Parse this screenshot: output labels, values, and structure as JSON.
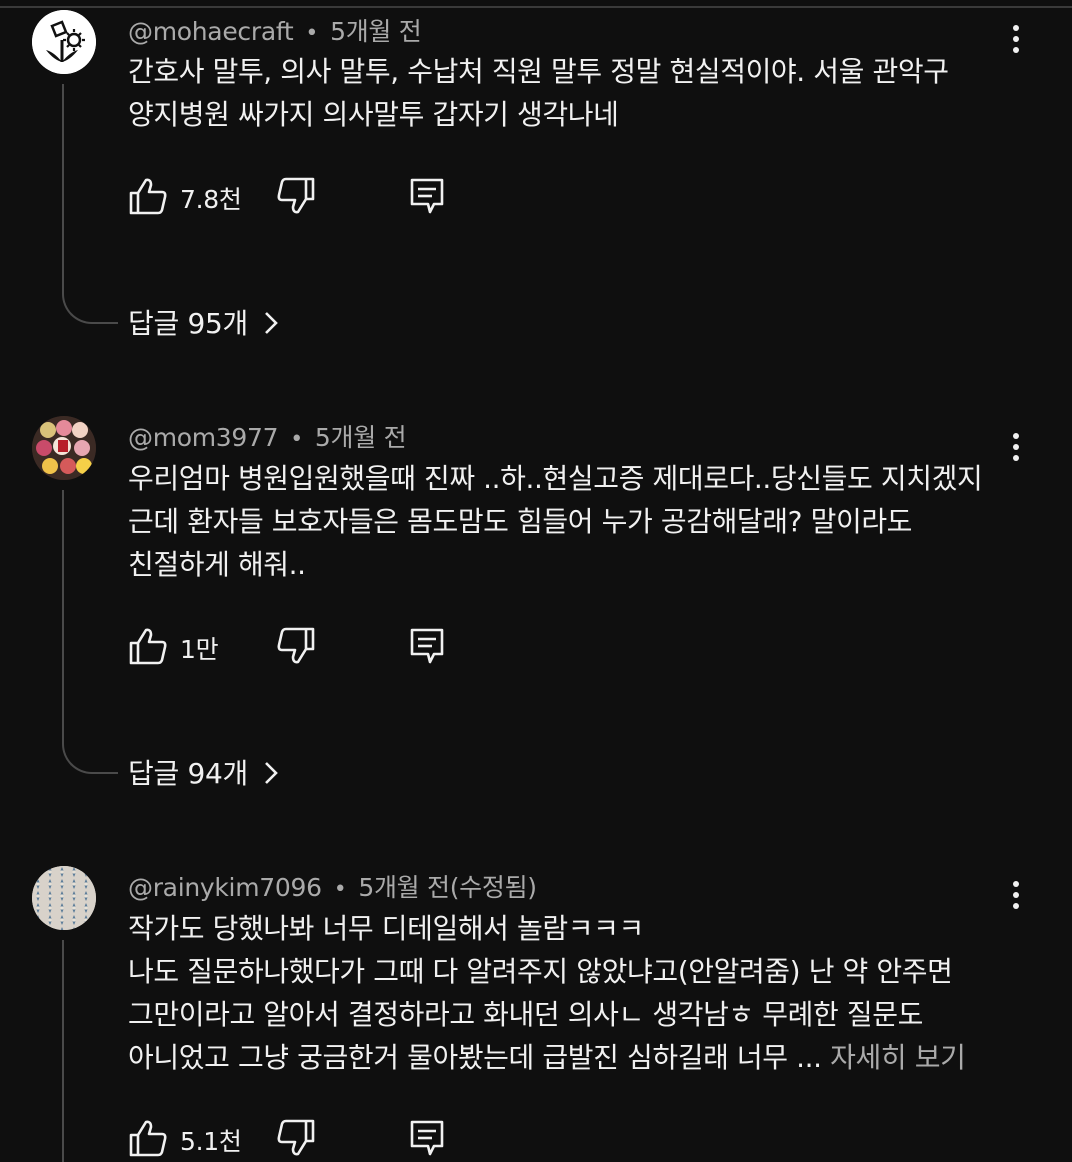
{
  "comments": [
    {
      "handle": "@mohaecraft",
      "time": "5개월 전",
      "lines": [
        "간호사 말투,  의사 말투, 수납처 직원 말투 정말 현실적이야. 서울 관악구",
        "양지병원 싸가지 의사말투 갑자기 생각나네"
      ],
      "likes": "7.8천",
      "replies": "답글 95개"
    },
    {
      "handle": "@mom3977",
      "time": "5개월 전",
      "lines": [
        "우리엄마 병원입원했을때 진짜 ..하..현실고증 제대로다..당신들도 지치겠지",
        "근데 환자들  보호자들은 몸도맘도 힘들어 누가 공감해달래? 말이라도",
        "친절하게 해줘.."
      ],
      "likes": "1만",
      "replies": "답글 94개"
    },
    {
      "handle": "@rainykim7096",
      "time": "5개월 전(수정됨)",
      "lines": [
        "작가도 당했나봐 너무 디테일해서 놀람ㅋㅋㅋ",
        "나도 질문하나했다가 그때 다 알려주지 않았냐고(안알려줌) 난 약 안주면",
        "그만이라고 알아서 결정하라고 화내던 의사ㄴ 생각남ㅎ 무례한 질문도",
        "아니었고 그냥 궁금한거 물아봤는데 급발진 심하길래 너무 ... "
      ],
      "more": "자세히 보기",
      "likes": "5.1천"
    }
  ],
  "icons": {
    "like": "thumbs-up-icon",
    "dislike": "thumbs-down-icon",
    "reply": "reply-icon",
    "menu": "more-vert-icon",
    "chevron": "chevron-right-icon"
  },
  "colors": {
    "background": "#0f0f0f",
    "text": "#f1f1f1",
    "secondary": "#aaaaaa",
    "thread": "#4a4a4a"
  }
}
